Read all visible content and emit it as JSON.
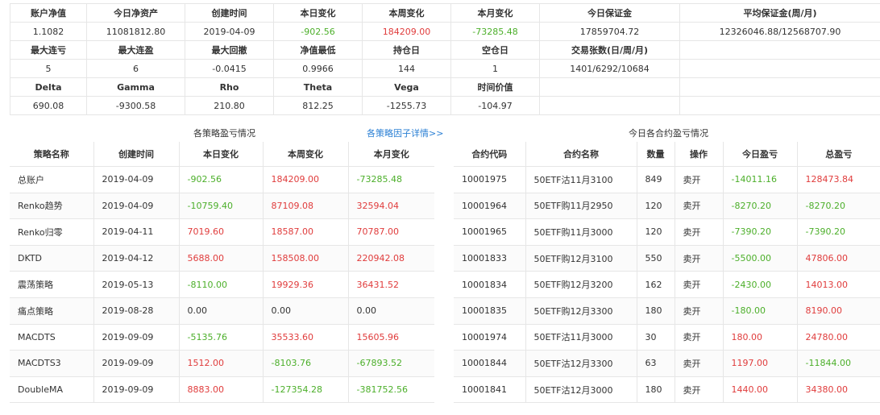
{
  "colors": {
    "positive": "#e03c3c",
    "negative": "#4caf2a",
    "link": "#2a7fd4"
  },
  "summary": {
    "row1_headers": [
      "账户净值",
      "今日净资产",
      "创建时间",
      "本日变化",
      "本周变化",
      "本月变化",
      "今日保证金",
      "平均保证金(周/月)"
    ],
    "row1_values": [
      "1.1082",
      "11081812.80",
      "2019-04-09",
      "-902.56",
      "184209.00",
      "-73285.48",
      "17859704.72",
      "12326046.88/12568707.90"
    ],
    "row1_signs": [
      "neu",
      "neu",
      "neu",
      "neg",
      "pos",
      "neg",
      "neu",
      "neu"
    ],
    "row2_headers": [
      "最大连亏",
      "最大连盈",
      "最大回撤",
      "净值最低",
      "持仓日",
      "空仓日",
      "交易张数(日/周/月)",
      ""
    ],
    "row2_values": [
      "5",
      "6",
      "-0.0415",
      "0.9966",
      "144",
      "1",
      "1401/6292/10684",
      ""
    ],
    "row3_headers": [
      "Delta",
      "Gamma",
      "Rho",
      "Theta",
      "Vega",
      "时间价值",
      "",
      ""
    ],
    "row3_values": [
      "690.08",
      "-9300.58",
      "210.80",
      "812.25",
      "-1255.73",
      "-104.97",
      "",
      ""
    ]
  },
  "strategy_section": {
    "title": "各策略盈亏情况",
    "link": "各策略因子详情>>"
  },
  "contract_section": {
    "title": "今日各合约盈亏情况"
  },
  "strategy_table": {
    "headers": [
      "策略名称",
      "创建时间",
      "本日变化",
      "本周变化",
      "本月变化"
    ],
    "rows": [
      {
        "name": "总账户",
        "created": "2019-04-09",
        "day": "-902.56",
        "week": "184209.00",
        "month": "-73285.48",
        "s": [
          "neg",
          "pos",
          "neg"
        ]
      },
      {
        "name": "Renko趋势",
        "created": "2019-04-09",
        "day": "-10759.40",
        "week": "87109.08",
        "month": "32594.04",
        "s": [
          "neg",
          "pos",
          "pos"
        ]
      },
      {
        "name": "Renko归零",
        "created": "2019-04-11",
        "day": "7019.60",
        "week": "18587.00",
        "month": "70787.00",
        "s": [
          "pos",
          "pos",
          "pos"
        ]
      },
      {
        "name": "DKTD",
        "created": "2019-04-12",
        "day": "5688.00",
        "week": "158508.00",
        "month": "220942.08",
        "s": [
          "pos",
          "pos",
          "pos"
        ]
      },
      {
        "name": "震荡策略",
        "created": "2019-05-13",
        "day": "-8110.00",
        "week": "19929.36",
        "month": "36431.52",
        "s": [
          "neg",
          "pos",
          "pos"
        ]
      },
      {
        "name": "痛点策略",
        "created": "2019-08-28",
        "day": "0.00",
        "week": "0.00",
        "month": "0.00",
        "s": [
          "neu",
          "neu",
          "neu"
        ]
      },
      {
        "name": "MACDTS",
        "created": "2019-09-09",
        "day": "-5135.76",
        "week": "35533.60",
        "month": "15605.96",
        "s": [
          "neg",
          "pos",
          "pos"
        ]
      },
      {
        "name": "MACDTS3",
        "created": "2019-09-09",
        "day": "1512.00",
        "week": "-8103.76",
        "month": "-67893.52",
        "s": [
          "pos",
          "neg",
          "neg"
        ]
      },
      {
        "name": "DoubleMA",
        "created": "2019-09-09",
        "day": "8883.00",
        "week": "-127354.28",
        "month": "-381752.56",
        "s": [
          "pos",
          "neg",
          "neg"
        ]
      }
    ]
  },
  "contract_table": {
    "headers": [
      "合约代码",
      "合约名称",
      "数量",
      "操作",
      "今日盈亏",
      "总盈亏"
    ],
    "rows": [
      {
        "code": "10001975",
        "name": "50ETF沽11月3100",
        "qty": "849",
        "op": "卖开",
        "today": "-14011.16",
        "total": "128473.84",
        "s": [
          "neg",
          "pos"
        ]
      },
      {
        "code": "10001964",
        "name": "50ETF购11月2950",
        "qty": "120",
        "op": "卖开",
        "today": "-8270.20",
        "total": "-8270.20",
        "s": [
          "neg",
          "neg"
        ]
      },
      {
        "code": "10001965",
        "name": "50ETF购11月3000",
        "qty": "120",
        "op": "卖开",
        "today": "-7390.20",
        "total": "-7390.20",
        "s": [
          "neg",
          "neg"
        ]
      },
      {
        "code": "10001833",
        "name": "50ETF购12月3100",
        "qty": "550",
        "op": "卖开",
        "today": "-5500.00",
        "total": "47806.00",
        "s": [
          "neg",
          "pos"
        ]
      },
      {
        "code": "10001834",
        "name": "50ETF购12月3200",
        "qty": "162",
        "op": "卖开",
        "today": "-2430.00",
        "total": "14013.00",
        "s": [
          "neg",
          "pos"
        ]
      },
      {
        "code": "10001835",
        "name": "50ETF购12月3300",
        "qty": "180",
        "op": "卖开",
        "today": "-180.00",
        "total": "8190.00",
        "s": [
          "neg",
          "pos"
        ]
      },
      {
        "code": "10001974",
        "name": "50ETF沽11月3000",
        "qty": "30",
        "op": "卖开",
        "today": "180.00",
        "total": "24780.00",
        "s": [
          "pos",
          "pos"
        ]
      },
      {
        "code": "10001844",
        "name": "50ETF沽12月3300",
        "qty": "63",
        "op": "卖开",
        "today": "1197.00",
        "total": "-11844.00",
        "s": [
          "pos",
          "neg"
        ]
      },
      {
        "code": "10001841",
        "name": "50ETF沽12月3000",
        "qty": "180",
        "op": "卖开",
        "today": "1440.00",
        "total": "34380.00",
        "s": [
          "pos",
          "pos"
        ]
      }
    ]
  }
}
